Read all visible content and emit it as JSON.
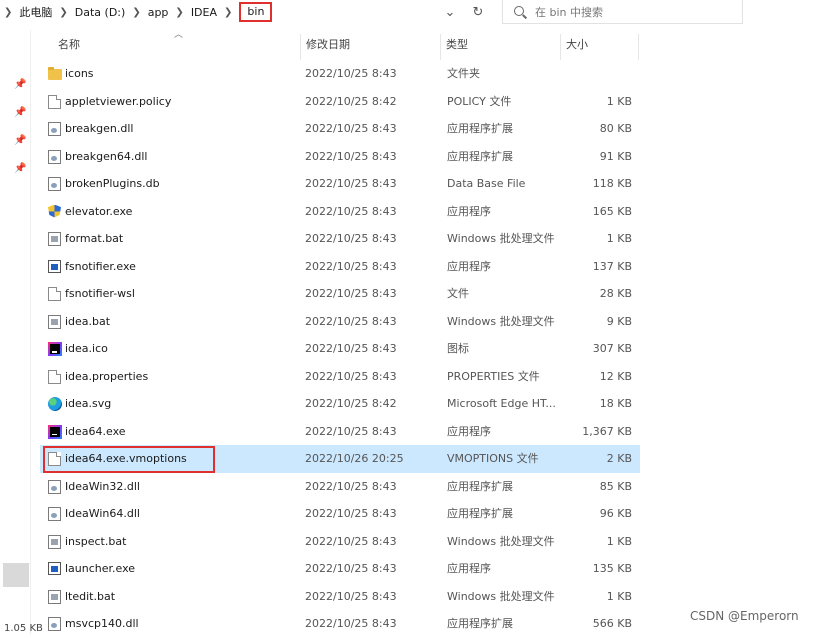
{
  "address_bar": {
    "breadcrumbs": [
      "此电脑",
      "Data (D:)",
      "app",
      "IDEA",
      "bin"
    ],
    "highlighted_segment": "bin"
  },
  "search": {
    "placeholder": "在 bin 中搜索"
  },
  "columns": {
    "name": "名称",
    "date": "修改日期",
    "type": "类型",
    "size": "大小"
  },
  "files": [
    {
      "name": "icons",
      "date": "2022/10/25 8:43",
      "type": "文件夹",
      "size": "",
      "icon": "folder-icon"
    },
    {
      "name": "appletviewer.policy",
      "date": "2022/10/25 8:42",
      "type": "POLICY 文件",
      "size": "1 KB",
      "icon": "file-icon"
    },
    {
      "name": "breakgen.dll",
      "date": "2022/10/25 8:43",
      "type": "应用程序扩展",
      "size": "80 KB",
      "icon": "dll-icon"
    },
    {
      "name": "breakgen64.dll",
      "date": "2022/10/25 8:43",
      "type": "应用程序扩展",
      "size": "91 KB",
      "icon": "dll-icon"
    },
    {
      "name": "brokenPlugins.db",
      "date": "2022/10/25 8:43",
      "type": "Data Base File",
      "size": "118 KB",
      "icon": "dll-icon"
    },
    {
      "name": "elevator.exe",
      "date": "2022/10/25 8:43",
      "type": "应用程序",
      "size": "165 KB",
      "icon": "elevator-icon"
    },
    {
      "name": "format.bat",
      "date": "2022/10/25 8:43",
      "type": "Windows 批处理文件",
      "size": "1 KB",
      "icon": "bat-icon"
    },
    {
      "name": "fsnotifier.exe",
      "date": "2022/10/25 8:43",
      "type": "应用程序",
      "size": "137 KB",
      "icon": "exe-icon"
    },
    {
      "name": "fsnotifier-wsl",
      "date": "2022/10/25 8:43",
      "type": "文件",
      "size": "28 KB",
      "icon": "file-icon"
    },
    {
      "name": "idea.bat",
      "date": "2022/10/25 8:43",
      "type": "Windows 批处理文件",
      "size": "9 KB",
      "icon": "bat-icon"
    },
    {
      "name": "idea.ico",
      "date": "2022/10/25 8:43",
      "type": "图标",
      "size": "307 KB",
      "icon": "idea-icon"
    },
    {
      "name": "idea.properties",
      "date": "2022/10/25 8:43",
      "type": "PROPERTIES 文件",
      "size": "12 KB",
      "icon": "file-icon"
    },
    {
      "name": "idea.svg",
      "date": "2022/10/25 8:42",
      "type": "Microsoft Edge HT...",
      "size": "18 KB",
      "icon": "edge-icon"
    },
    {
      "name": "idea64.exe",
      "date": "2022/10/25 8:43",
      "type": "应用程序",
      "size": "1,367 KB",
      "icon": "idea-icon"
    },
    {
      "name": "idea64.exe.vmoptions",
      "date": "2022/10/26 20:25",
      "type": "VMOPTIONS 文件",
      "size": "2 KB",
      "icon": "file-icon",
      "selected": true
    },
    {
      "name": "IdeaWin32.dll",
      "date": "2022/10/25 8:43",
      "type": "应用程序扩展",
      "size": "85 KB",
      "icon": "dll-icon"
    },
    {
      "name": "IdeaWin64.dll",
      "date": "2022/10/25 8:43",
      "type": "应用程序扩展",
      "size": "96 KB",
      "icon": "dll-icon"
    },
    {
      "name": "inspect.bat",
      "date": "2022/10/25 8:43",
      "type": "Windows 批处理文件",
      "size": "1 KB",
      "icon": "bat-icon"
    },
    {
      "name": "launcher.exe",
      "date": "2022/10/25 8:43",
      "type": "应用程序",
      "size": "135 KB",
      "icon": "exe-icon"
    },
    {
      "name": "ltedit.bat",
      "date": "2022/10/25 8:43",
      "type": "Windows 批处理文件",
      "size": "1 KB",
      "icon": "bat-icon"
    },
    {
      "name": "msvcp140.dll",
      "date": "2022/10/25 8:43",
      "type": "应用程序扩展",
      "size": "566 KB",
      "icon": "dll-icon"
    }
  ],
  "status_bar": {
    "selection_size": "1.05 KB"
  },
  "watermark": "CSDN @Emperorn"
}
